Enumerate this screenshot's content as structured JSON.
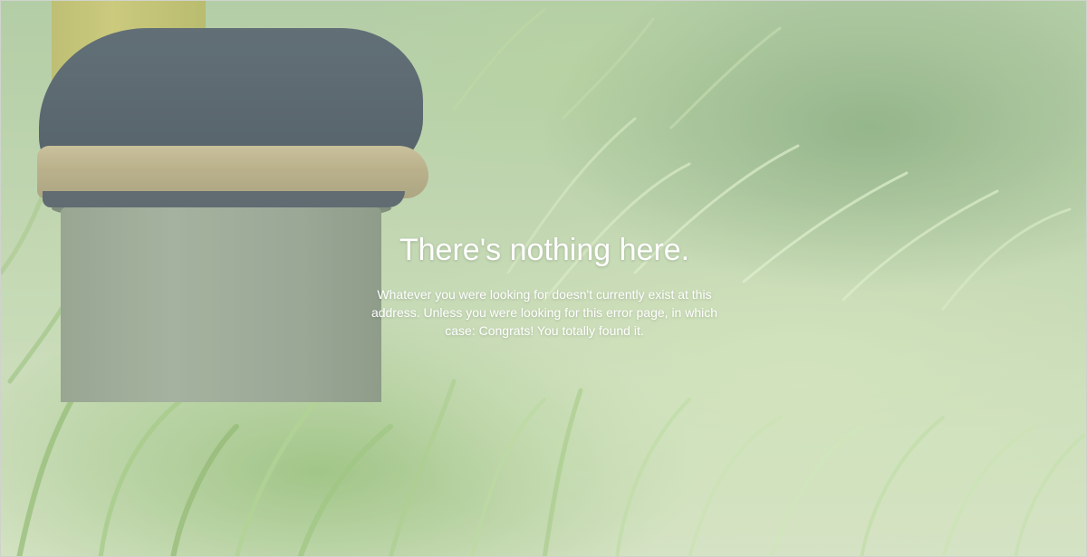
{
  "error_page": {
    "heading": "There's nothing here.",
    "message": "Whatever you were looking for doesn't currently exist at this address. Unless you were looking for this error page, in which case: Congrats! You totally found it."
  },
  "background": {
    "image_subject": "shoe-on-stump-in-grass",
    "colors": {
      "grass_light": "#d0e0bd",
      "grass_mid": "#b7d0a5",
      "grass_dark": "#a9c79a",
      "stump": "#8e9c88",
      "shoe": "#45545d",
      "sole": "#b1a77c",
      "sock": "#c4c36c",
      "text": "#ffffff"
    }
  }
}
